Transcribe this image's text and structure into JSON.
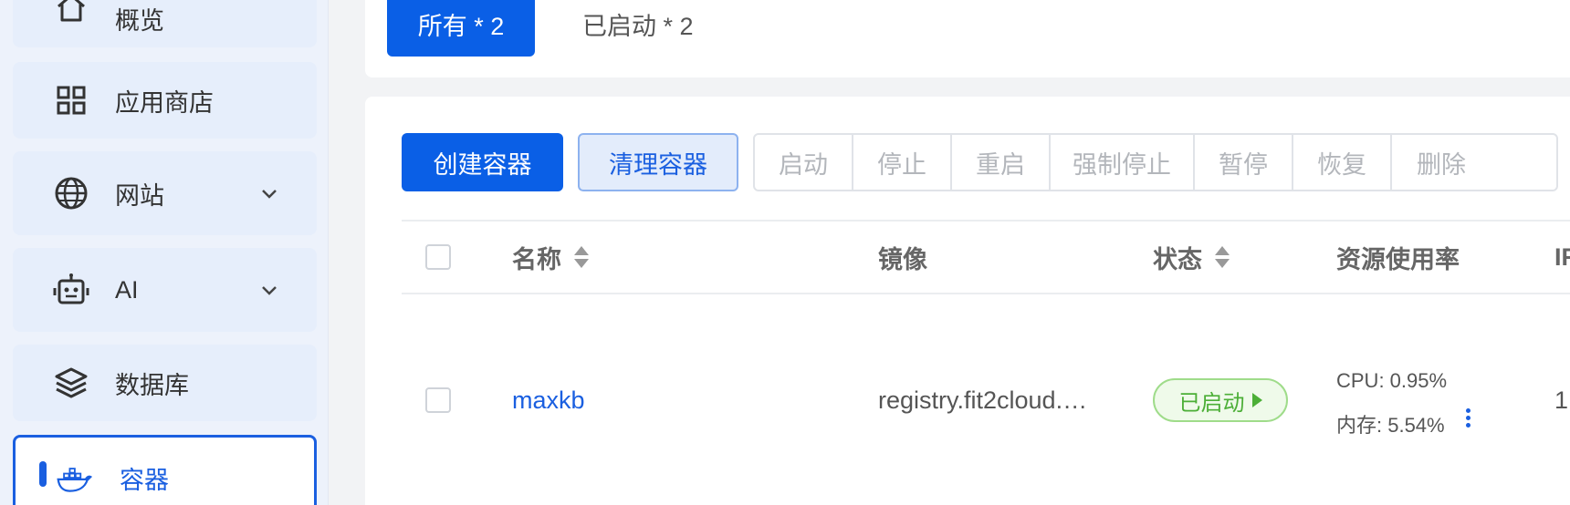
{
  "sidebar": {
    "items": [
      {
        "label": "概览",
        "icon": "home-icon"
      },
      {
        "label": "应用商店",
        "icon": "grid-icon"
      },
      {
        "label": "网站",
        "icon": "globe-icon"
      },
      {
        "label": "AI",
        "icon": "robot-icon"
      },
      {
        "label": "数据库",
        "icon": "layers-icon"
      },
      {
        "label": "容器",
        "icon": "docker-icon"
      }
    ]
  },
  "tabs": {
    "all": "所有 * 2",
    "running": "已启动 * 2"
  },
  "toolbar": {
    "create": "创建容器",
    "clean": "清理容器",
    "group": [
      "启动",
      "停止",
      "重启",
      "强制停止",
      "暂停",
      "恢复",
      "删除"
    ]
  },
  "table": {
    "headers": {
      "name": "名称",
      "image": "镜像",
      "status": "状态",
      "resource": "资源使用率",
      "ip": "IF"
    },
    "rows": [
      {
        "name": "maxkb",
        "image": "registry.fit2cloud.…",
        "status": "已启动",
        "cpu": "CPU: 0.95%",
        "mem": "内存: 5.54%",
        "ip": "1"
      }
    ]
  },
  "colors": {
    "accent": "#0a5fe6",
    "success": "#4caf37"
  }
}
